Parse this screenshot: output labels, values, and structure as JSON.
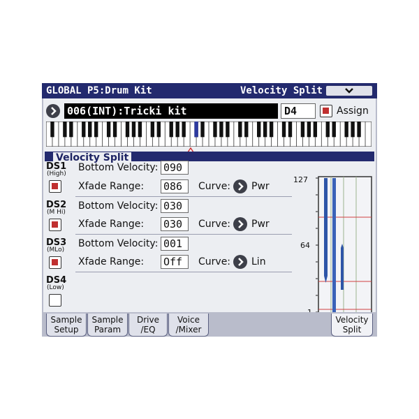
{
  "header": {
    "title": "GLOBAL  P5:Drum Kit",
    "page_name": "Velocity Split"
  },
  "kit": {
    "name": "006(INT):Tricki kit",
    "note": "D4",
    "assign_label": "Assign"
  },
  "section": {
    "title": "Velocity Split"
  },
  "splits": [
    {
      "name": "DS1",
      "range_label": "(High)",
      "enabled": true,
      "bottom_label": "Bottom Velocity:",
      "bottom_value": "090",
      "xfade_label": "Xfade Range:",
      "xfade_value": "086",
      "curve_label": "Curve:",
      "curve_value": "Pwr"
    },
    {
      "name": "DS2",
      "range_label": "(M Hi)",
      "enabled": true,
      "bottom_label": "Bottom Velocity:",
      "bottom_value": "030",
      "xfade_label": "Xfade Range:",
      "xfade_value": "030",
      "curve_label": "Curve:",
      "curve_value": "Pwr"
    },
    {
      "name": "DS3",
      "range_label": "(MLo)",
      "enabled": true,
      "bottom_label": "Bottom Velocity:",
      "bottom_value": "001",
      "xfade_label": "Xfade Range:",
      "xfade_value": "Off",
      "curve_label": "Curve:",
      "curve_value": "Lin"
    },
    {
      "name": "DS4",
      "range_label": "(Low)",
      "enabled": false
    }
  ],
  "graph": {
    "tick_top": "127",
    "tick_mid": "64",
    "tick_bottom": "1"
  },
  "tabs": [
    {
      "line1": "Sample",
      "line2": "Setup"
    },
    {
      "line1": "Sample",
      "line2": "Param"
    },
    {
      "line1": "Drive",
      "line2": "/EQ"
    },
    {
      "line1": "Voice",
      "line2": "/Mixer"
    },
    {
      "line1": "Velocity",
      "line2": "Split"
    }
  ],
  "colors": {
    "title_bar": "#232a6e",
    "check_on": "#c03030",
    "graph_bar": "#3a62b8",
    "split_line": "#d04040"
  }
}
